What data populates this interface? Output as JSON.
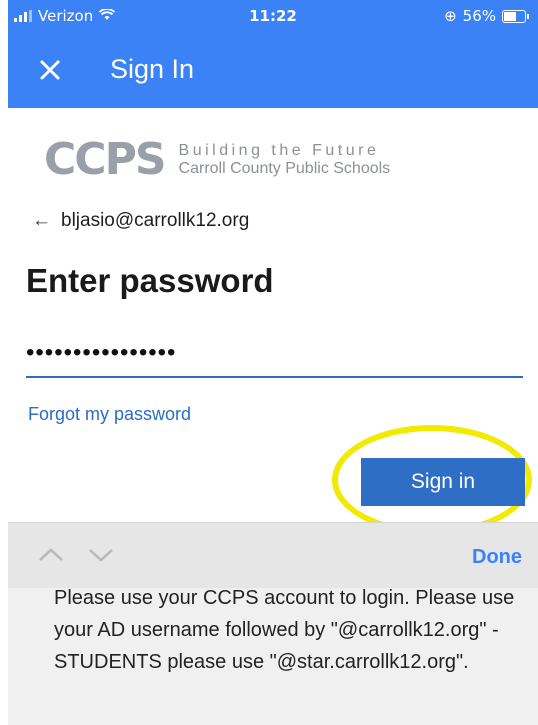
{
  "status_bar": {
    "carrier": "Verizon",
    "time": "11:22",
    "battery": "56%"
  },
  "header": {
    "title": "Sign In",
    "close_icon": "close-icon"
  },
  "logo": {
    "mark": "CCPS",
    "line1": "Building the Future",
    "line2": "Carroll County Public Schools"
  },
  "account": {
    "email": "bljasio@carrollk12.org",
    "back_icon": "back-arrow-icon"
  },
  "form": {
    "heading": "Enter password",
    "password_value": "••••••••••••••••",
    "forgot_link": "Forgot my password",
    "signin_button": "Sign in"
  },
  "keyboard_toolbar": {
    "done": "Done"
  },
  "notice": {
    "text": "Please use your CCPS account to login. Please use your AD username followed by \"@carrollk12.org\" - STUDENTS please use \"@star.carrollk12.org\"."
  },
  "colors": {
    "brand_blue": "#3b82f6",
    "button_blue": "#2f6ec5",
    "highlight": "#f2ea00"
  }
}
